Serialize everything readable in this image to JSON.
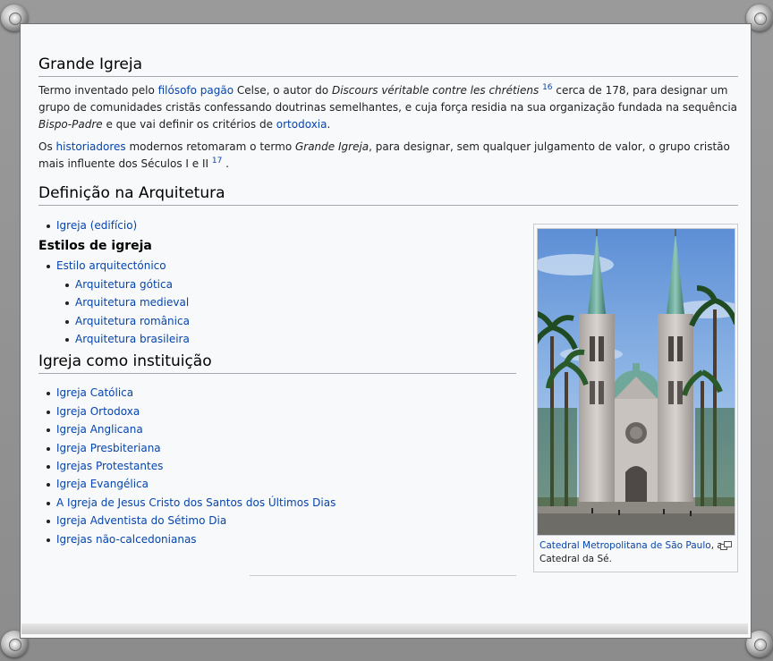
{
  "section1": {
    "heading": "Grande Igreja",
    "p1": {
      "t1": "Termo inventado pelo ",
      "link1": "filósofo pagão",
      "t2": " Celse, o autor do ",
      "em1": "Discours véritable contre les chrétiens",
      "sup1": "16",
      "t3": " cerca de 178, para designar um grupo de comunidades cristãs confessando doutrinas semelhantes, e cuja força residia na sua organização fundada na sequência ",
      "em2": "Bispo-Padre",
      "t4": " e que vai definir os critérios de ",
      "link2": "ortodoxia",
      "t5": "."
    },
    "p2": {
      "t1": "Os ",
      "link1": "historiadores",
      "t2": " modernos retomaram o termo ",
      "em1": "Grande Igreja",
      "t3": ", para designar, sem qualquer julgamento de valor, o grupo cristão mais influente dos Séculos I e II ",
      "sup1": "17",
      "t4": " ."
    }
  },
  "section2": {
    "heading": "Definição na Arquitetura",
    "item1": "Igreja (edifício)",
    "subheading": "Estilos de igreja",
    "style_top": "Estilo arquitectónico",
    "styles": [
      "Arquitetura gótica",
      "Arquitetura medieval",
      "Arquitetura românica",
      "Arquitetura brasileira"
    ]
  },
  "section3": {
    "heading": "Igreja como instituição",
    "items": [
      "Igreja Católica",
      "Igreja Ortodoxa",
      "Igreja Anglicana",
      "Igreja Presbiteriana",
      "Igrejas Protestantes",
      "Igreja Evangélica",
      "A Igreja de Jesus Cristo dos Santos dos Últimos Dias",
      "Igreja Adventista do Sétimo Dia",
      "Igrejas não-calcedonianas"
    ]
  },
  "figure": {
    "caption_link": "Catedral Metropolitana de São Paulo",
    "caption_rest": ", a Catedral da Sé."
  },
  "colors": {
    "link": "#0645ad",
    "text": "#202122",
    "frame": "#8f8f8f"
  }
}
